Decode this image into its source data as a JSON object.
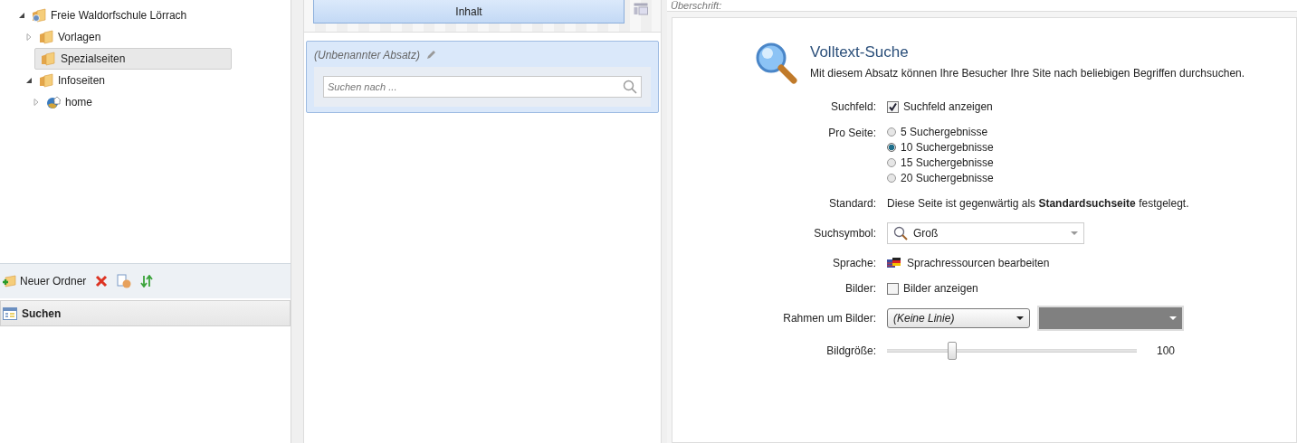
{
  "tree": [
    {
      "label": "Freie Waldorfschule Lörrach",
      "kind": "site",
      "expanded": true,
      "selected": false,
      "children": [
        {
          "label": "Vorlagen",
          "kind": "folder",
          "expanded": false,
          "selected": false
        },
        {
          "label": "Spezialseiten",
          "kind": "folder",
          "selected": true
        },
        {
          "label": "Infoseiten",
          "kind": "folder",
          "expanded": true,
          "selected": false,
          "children": [
            {
              "label": "home",
              "kind": "home",
              "expanded": false,
              "selected": false
            }
          ]
        }
      ]
    }
  ],
  "toolbar": {
    "new_folder": "Neuer Ordner"
  },
  "panel_header": "Suchen",
  "content_button": "Inhalt",
  "paragraph": {
    "title": "(Unbenannter Absatz)",
    "search_placeholder": "Suchen nach ..."
  },
  "heading_field": {
    "placeholder": "Überschrift:"
  },
  "module": {
    "title": "Volltext-Suche",
    "description": "Mit diesem Absatz können Ihre Besucher Ihre Site nach beliebigen Begriffen durchsuchen."
  },
  "form": [
    {
      "kind": "checkbox",
      "label": "Suchfeld:",
      "text": "Suchfeld anzeigen",
      "checked": true
    },
    {
      "kind": "radios",
      "label": "Pro Seite:",
      "options": [
        {
          "text": "5 Suchergebnisse",
          "selected": false
        },
        {
          "text": "10 Suchergebnisse",
          "selected": true
        },
        {
          "text": "15 Suchergebnisse",
          "selected": false
        },
        {
          "text": "20 Suchergebnisse",
          "selected": false
        }
      ]
    },
    {
      "kind": "text",
      "label": "Standard:",
      "text": "Diese Seite ist gegenwärtig als **Standardsuchseite** festgelegt."
    },
    {
      "kind": "select",
      "label": "Suchsymbol:",
      "value": "Groß"
    },
    {
      "kind": "link",
      "label": "Sprache:",
      "text": "Sprachressourcen bearbeiten"
    },
    {
      "kind": "checkbox",
      "label": "Bilder:",
      "text": "Bilder anzeigen",
      "checked": false
    },
    {
      "kind": "border",
      "label": "Rahmen um Bilder:",
      "value": "(Keine Linie)",
      "color": "#808080"
    },
    {
      "kind": "slider",
      "label": "Bildgröße:",
      "level": 0.26,
      "reading": "100"
    }
  ]
}
